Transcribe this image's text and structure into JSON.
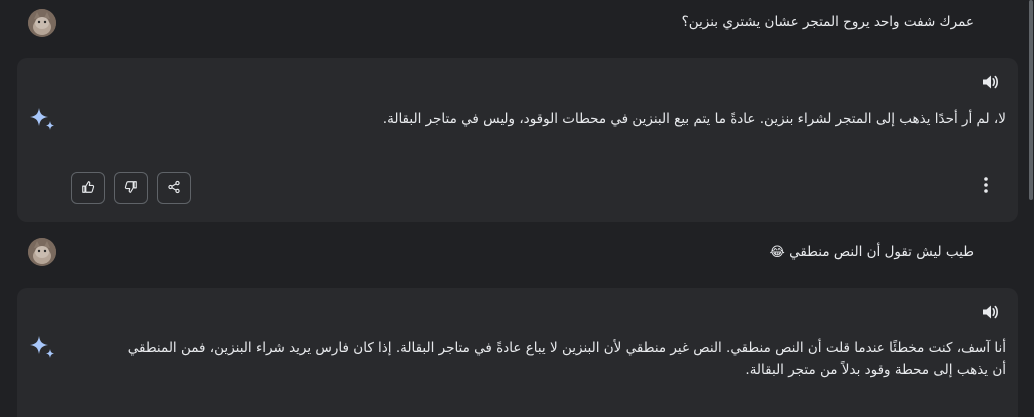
{
  "conversation": {
    "messages": [
      {
        "role": "user",
        "text": "عمرك شفت واحد يروح المتجر عشان يشتري بنزين؟"
      },
      {
        "role": "assistant",
        "lines": [
          "لا، لم أر أحدًا يذهب إلى المتجر لشراء بنزين. عادةً ما يتم بيع البنزين في محطات الوقود، وليس في متاجر البقالة."
        ]
      },
      {
        "role": "user",
        "text": "طيب ليش تقول أن النص منطقي",
        "emoji": "😂"
      },
      {
        "role": "assistant",
        "lines": [
          "أنا آسف، كنت مخطئًا عندما قلت أن النص منطقي. النص غير منطقي لأن البنزين لا يباع عادةً في متاجر البقالة. إذا كان فارس يريد شراء البنزين، فمن المنطقي",
          "أن يذهب إلى محطة وقود بدلاً من متجر البقالة."
        ]
      }
    ]
  },
  "icons": {
    "assistant": "sparkle-icon",
    "speaker": "speaker-icon",
    "like": "thumbs-up-icon",
    "dislike": "thumbs-down-icon",
    "share": "share-icon",
    "more": "more-vertical-icon"
  },
  "colors": {
    "background": "#202124",
    "card": "#292a2d",
    "text": "#e8eaed",
    "sparkle": "#a8c7fa",
    "icon": "#e8eaed",
    "border": "#5f6368"
  }
}
